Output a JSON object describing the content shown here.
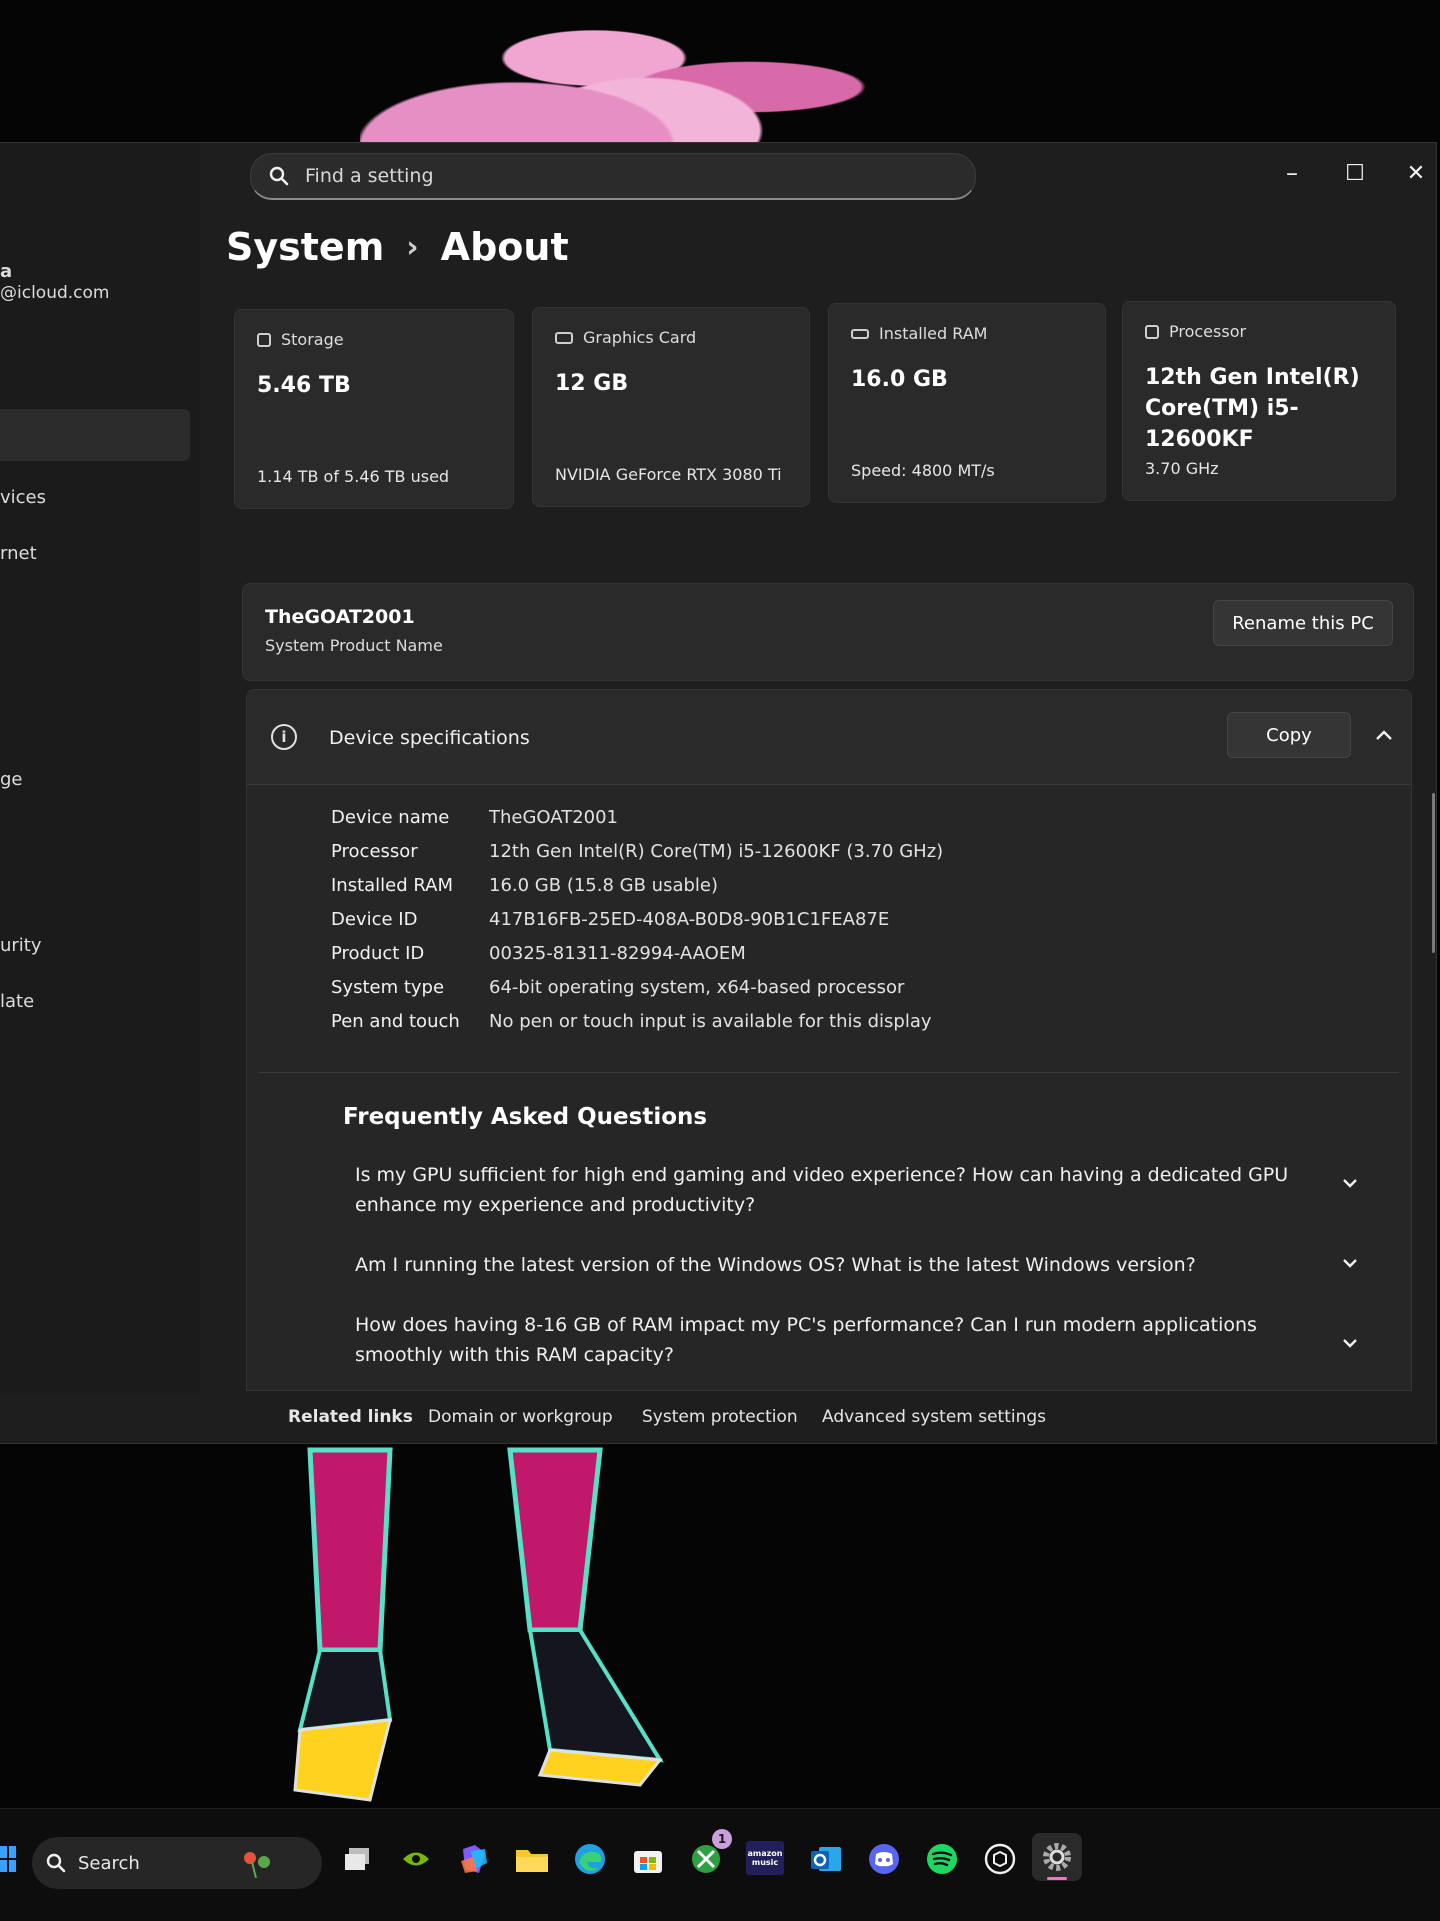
{
  "window": {
    "search_placeholder": "Find a setting",
    "controls": {
      "minimize": "–",
      "maximize": "☐",
      "close": "✕"
    }
  },
  "sidebar": {
    "account_name_fragment": "a",
    "account_email_fragment": "@icloud.com",
    "items": [
      "vices",
      "rnet",
      "ge",
      "urity",
      "late"
    ]
  },
  "breadcrumb": {
    "parent": "System",
    "separator": "›",
    "current": "About"
  },
  "cards": [
    {
      "label": "Storage",
      "value": "5.46 TB",
      "detail": "1.14 TB of 5.46 TB used",
      "icon": "storage-icon"
    },
    {
      "label": "Graphics Card",
      "value": "12 GB",
      "detail": "NVIDIA GeForce RTX 3080 Ti",
      "icon": "graphics-card-icon"
    },
    {
      "label": "Installed RAM",
      "value": "16.0 GB",
      "detail": "Speed: 4800 MT/s",
      "icon": "ram-icon"
    },
    {
      "label": "Processor",
      "value": "12th Gen Intel(R) Core(TM) i5-12600KF",
      "detail": "3.70 GHz",
      "icon": "processor-icon"
    }
  ],
  "pc": {
    "name": "TheGOAT2001",
    "subtitle": "System Product Name",
    "rename_label": "Rename this PC"
  },
  "specs": {
    "title": "Device specifications",
    "copy_label": "Copy",
    "rows": [
      {
        "key": "Device name",
        "value": "TheGOAT2001"
      },
      {
        "key": "Processor",
        "value": "12th Gen Intel(R) Core(TM) i5-12600KF (3.70 GHz)"
      },
      {
        "key": "Installed RAM",
        "value": "16.0 GB (15.8 GB usable)"
      },
      {
        "key": "Device ID",
        "value": "417B16FB-25ED-408A-B0D8-90B1C1FEA87E"
      },
      {
        "key": "Product ID",
        "value": "00325-81311-82994-AAOEM"
      },
      {
        "key": "System type",
        "value": "64-bit operating system, x64-based processor"
      },
      {
        "key": "Pen and touch",
        "value": "No pen or touch input is available for this display"
      }
    ]
  },
  "faq": {
    "title": "Frequently Asked Questions",
    "items": [
      "Is my GPU sufficient for high end gaming and video experience? How can having a dedicated GPU enhance my experience and productivity?",
      "Am I running the latest version of the Windows OS? What is the latest Windows version?",
      "How does having 8-16 GB of RAM impact my PC's performance? Can I run modern applications smoothly with this RAM capacity?"
    ]
  },
  "related": {
    "label": "Related links",
    "links": [
      "Domain or workgroup",
      "System protection",
      "Advanced system settings"
    ]
  },
  "taskbar": {
    "search_label": "Search",
    "xbox_badge": "1",
    "amazon_music_label": "amazon music"
  }
}
